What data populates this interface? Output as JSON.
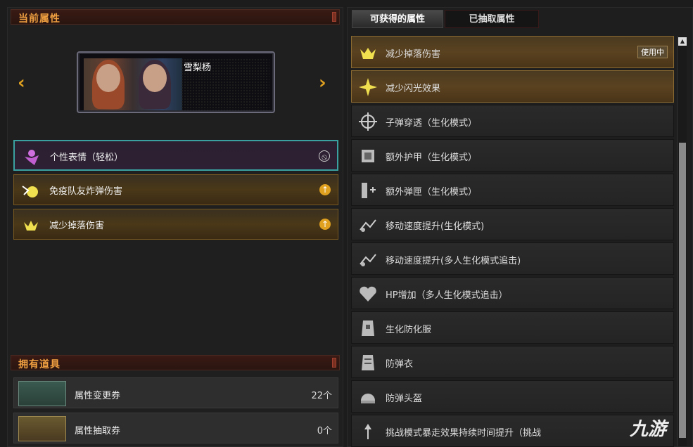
{
  "left": {
    "current_header": "当前属性",
    "character_name": "雪梨杨",
    "attributes": [
      {
        "label": "个性表情（轻松）",
        "action": "⦸"
      },
      {
        "label": "免疫队友炸弹伤害",
        "action": "↑"
      },
      {
        "label": "减少掉落伤害",
        "action": "↑"
      }
    ],
    "items_header": "拥有道具",
    "items": [
      {
        "label": "属性变更券",
        "count": "22个"
      },
      {
        "label": "属性抽取券",
        "count": "0个"
      }
    ]
  },
  "right": {
    "tabs": [
      "可获得的属性",
      "已抽取属性"
    ],
    "list": [
      {
        "label": "减少掉落伤害",
        "badge": "使用中"
      },
      {
        "label": "减少闪光效果"
      },
      {
        "label": "子弹穿透（生化模式）"
      },
      {
        "label": "额外护甲（生化模式）"
      },
      {
        "label": "额外弹匣（生化模式）"
      },
      {
        "label": "移动速度提升(生化模式)"
      },
      {
        "label": "移动速度提升(多人生化模式追击)"
      },
      {
        "label": "HP增加（多人生化模式追击）"
      },
      {
        "label": "生化防化服"
      },
      {
        "label": "防弹衣"
      },
      {
        "label": "防弹头盔"
      },
      {
        "label": "挑战模式暴走效果持续时间提升（挑战"
      }
    ]
  },
  "watermark": "九游",
  "colors": {
    "accent": "#f0a040",
    "gold_border": "#8a6a30",
    "selected_border": "#3aa0a0"
  }
}
